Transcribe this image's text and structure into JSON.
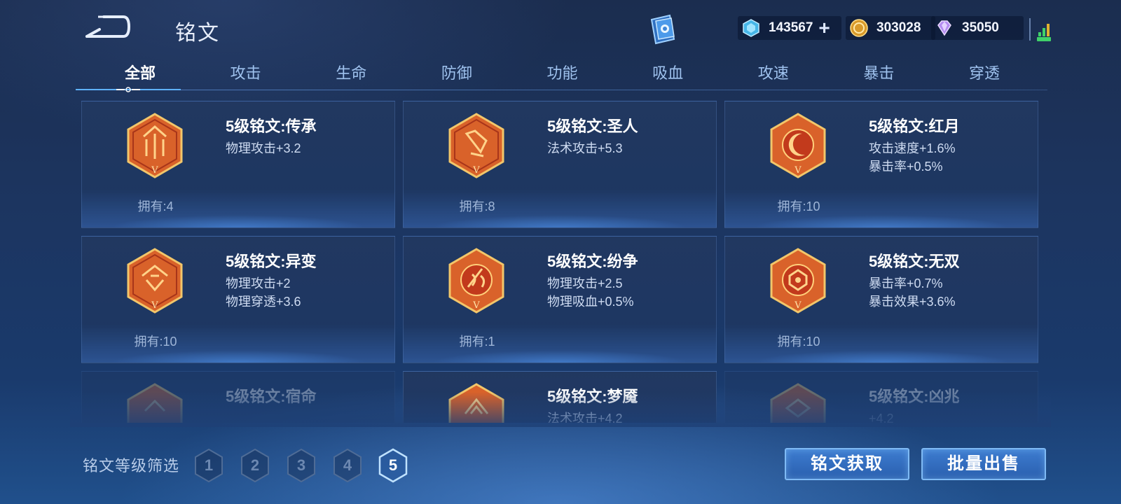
{
  "header": {
    "title": "铭文",
    "currencies": [
      {
        "icon": "diamond-coupon-icon",
        "value": "143567"
      },
      {
        "icon": "gold-coin-icon",
        "value": "303028"
      },
      {
        "icon": "purple-crystal-icon",
        "value": "35050"
      }
    ]
  },
  "tabs": [
    "全部",
    "攻击",
    "生命",
    "防御",
    "功能",
    "吸血",
    "攻速",
    "暴击",
    "穿透"
  ],
  "active_tab": "全部",
  "inscriptions": [
    {
      "name": "5级铭文:传承",
      "stats": [
        "物理攻击+3.2"
      ],
      "owned": "拥有:4",
      "icon": "inheritance-emblem-icon"
    },
    {
      "name": "5级铭文:圣人",
      "stats": [
        "法术攻击+5.3"
      ],
      "owned": "拥有:8",
      "icon": "sage-emblem-icon"
    },
    {
      "name": "5级铭文:红月",
      "stats": [
        "攻击速度+1.6%",
        "暴击率+0.5%"
      ],
      "owned": "拥有:10",
      "icon": "red-moon-emblem-icon"
    },
    {
      "name": "5级铭文:异变",
      "stats": [
        "物理攻击+2",
        "物理穿透+3.6"
      ],
      "owned": "拥有:10",
      "icon": "mutation-emblem-icon"
    },
    {
      "name": "5级铭文:纷争",
      "stats": [
        "物理攻击+2.5",
        "物理吸血+0.5%"
      ],
      "owned": "拥有:1",
      "icon": "discord-emblem-icon"
    },
    {
      "name": "5级铭文:无双",
      "stats": [
        "暴击率+0.7%",
        "暴击效果+3.6%"
      ],
      "owned": "拥有:10",
      "icon": "peerless-emblem-icon"
    },
    {
      "name": "5级铭文:宿命",
      "stats": [],
      "owned": "",
      "icon": "fate-emblem-icon"
    },
    {
      "name": "5级铭文:梦魇",
      "stats": [
        "法术攻击+4.2"
      ],
      "owned": "",
      "icon": "nightmare-emblem-icon"
    },
    {
      "name": "5级铭文:凶兆",
      "stats": [
        "+4.2"
      ],
      "owned": "",
      "icon": "omen-emblem-icon"
    }
  ],
  "filter": {
    "label": "铭文等级筛选",
    "levels": [
      "1",
      "2",
      "3",
      "4",
      "5"
    ],
    "selected": "5"
  },
  "buttons": {
    "acquire": "铭文获取",
    "batch_sell": "批量出售"
  }
}
